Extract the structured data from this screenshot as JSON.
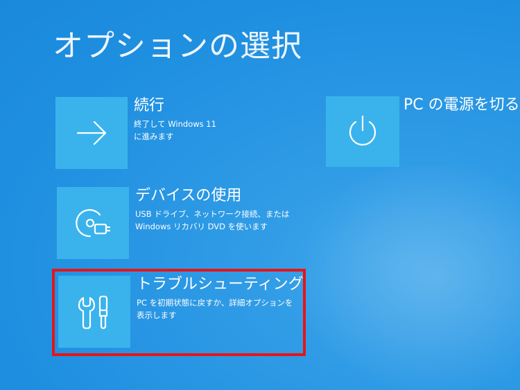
{
  "screen": {
    "title": "オプションの選択"
  },
  "options": {
    "continue": {
      "title": "続行",
      "desc_line1": "終了して Windows 11",
      "desc_line2": "に進みます",
      "icon": "arrow-right-icon"
    },
    "use_device": {
      "title": "デバイスの使用",
      "desc_line1": "USB ドライブ、ネットワーク接続、または",
      "desc_line2": "Windows リカバリ DVD を使います",
      "icon": "disc-device-icon"
    },
    "troubleshoot": {
      "title": "トラブルシューティング",
      "desc_line1": "PC を初期状態に戻すか、詳細オプションを",
      "desc_line2": "表示します",
      "icon": "tools-icon"
    },
    "power_off": {
      "title": "PC の電源を切る",
      "icon": "power-icon"
    }
  },
  "highlight": {
    "color": "#e81416",
    "target": "troubleshoot"
  },
  "colors": {
    "background": "#1f8fe0",
    "tile": "#3ab3ec"
  }
}
